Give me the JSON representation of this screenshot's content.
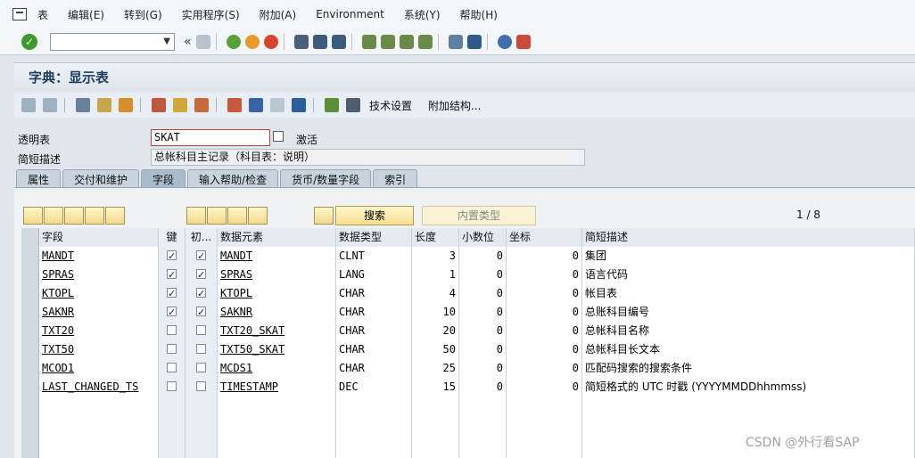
{
  "menu": [
    "表",
    "编辑(E)",
    "转到(G)",
    "实用程序(S)",
    "附加(A)",
    "Environment",
    "系统(Y)",
    "帮助(H)"
  ],
  "title": "字典：显示表",
  "app_toolbar": {
    "tech_settings": "技术设置",
    "append_struct": "附加结构..."
  },
  "header": {
    "table_label": "透明表",
    "table_value": "SKAT",
    "status": "激活",
    "desc_label": "简短描述",
    "desc_value": "总帐科目主记录（科目表：说明）"
  },
  "tabs": [
    "属性",
    "交付和维护",
    "字段",
    "输入帮助/检查",
    "货币/数量字段",
    "索引"
  ],
  "active_tab": "字段",
  "search_btn": "搜索",
  "builtin_btn": "内置类型",
  "pager": "1 / 8",
  "columns": [
    "字段",
    "键",
    "初...",
    "数据元素",
    "数据类型",
    "长度",
    "小数位",
    "坐标",
    "简短描述"
  ],
  "rows": [
    {
      "field": "MANDT",
      "key": true,
      "init": true,
      "elem": "MANDT",
      "type": "CLNT",
      "len": "3",
      "dec": "0",
      "coord": "0",
      "desc": "集团"
    },
    {
      "field": "SPRAS",
      "key": true,
      "init": true,
      "elem": "SPRAS",
      "type": "LANG",
      "len": "1",
      "dec": "0",
      "coord": "0",
      "desc": "语言代码"
    },
    {
      "field": "KTOPL",
      "key": true,
      "init": true,
      "elem": "KTOPL",
      "type": "CHAR",
      "len": "4",
      "dec": "0",
      "coord": "0",
      "desc": "帐目表"
    },
    {
      "field": "SAKNR",
      "key": true,
      "init": true,
      "elem": "SAKNR",
      "type": "CHAR",
      "len": "10",
      "dec": "0",
      "coord": "0",
      "desc": "总账科目编号"
    },
    {
      "field": "TXT20",
      "key": false,
      "init": false,
      "elem": "TXT20_SKAT",
      "type": "CHAR",
      "len": "20",
      "dec": "0",
      "coord": "0",
      "desc": "总帐科目名称"
    },
    {
      "field": "TXT50",
      "key": false,
      "init": false,
      "elem": "TXT50_SKAT",
      "type": "CHAR",
      "len": "50",
      "dec": "0",
      "coord": "0",
      "desc": "总帐科目长文本"
    },
    {
      "field": "MCOD1",
      "key": false,
      "init": false,
      "elem": "MCDS1",
      "type": "CHAR",
      "len": "25",
      "dec": "0",
      "coord": "0",
      "desc": "匹配码搜索的搜索条件"
    },
    {
      "field": "LAST_CHANGED_TS",
      "key": false,
      "init": false,
      "elem": "TIMESTAMP",
      "type": "DEC",
      "len": "15",
      "dec": "0",
      "coord": "0",
      "desc": "简短格式的 UTC 时戳 (YYYYMMDDhhmmss)"
    }
  ],
  "watermark": "CSDN @外行看SAP"
}
